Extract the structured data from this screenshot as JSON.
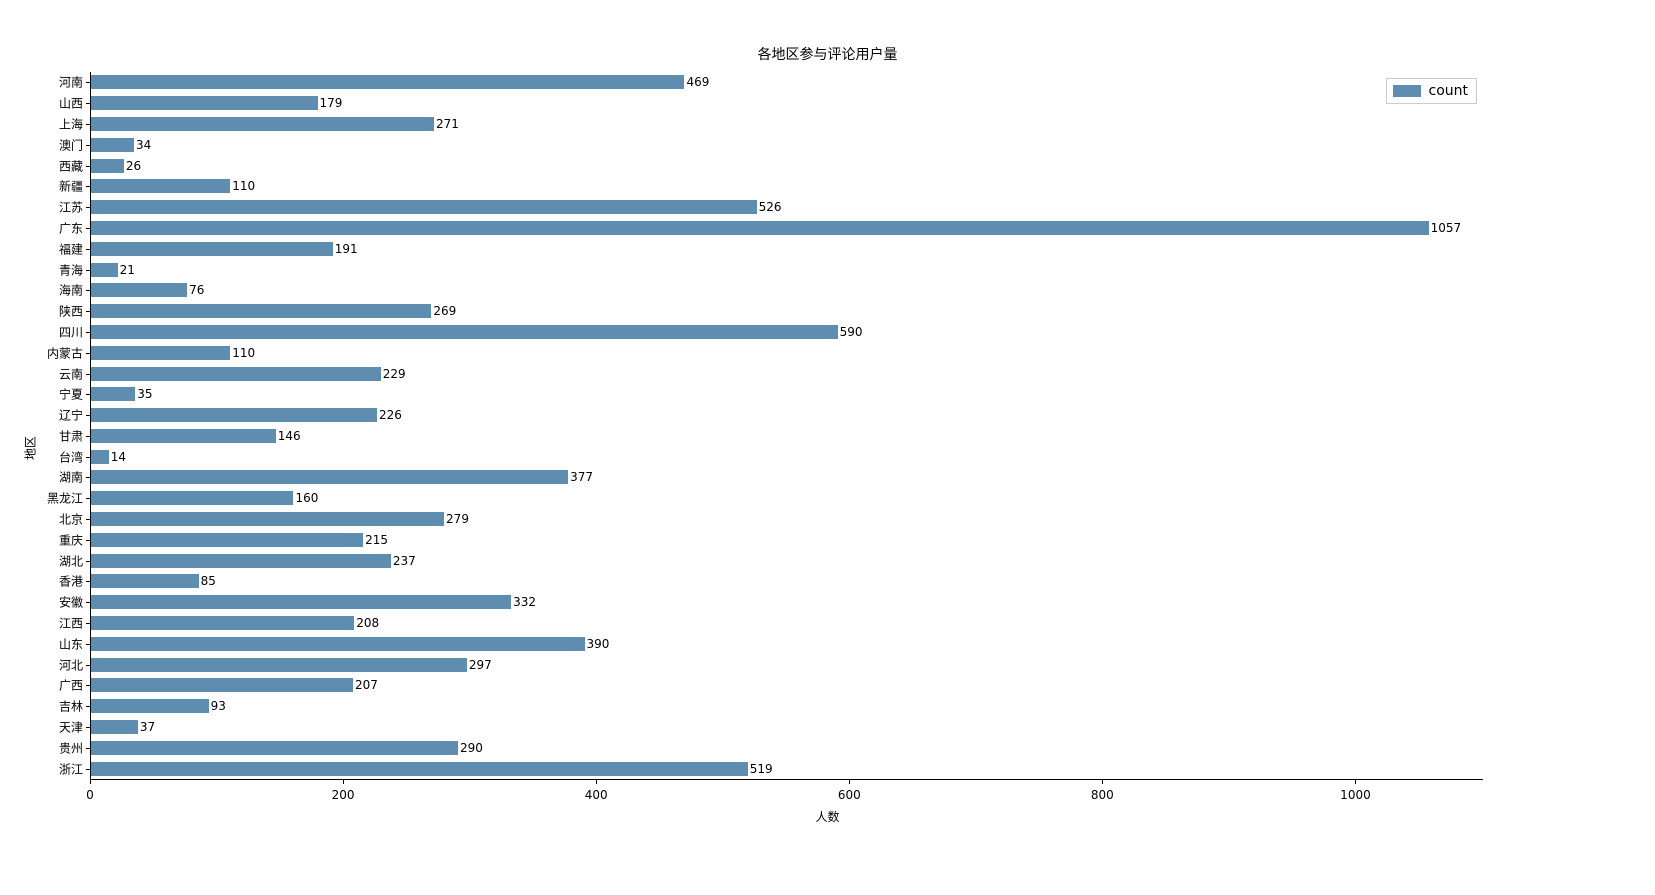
{
  "chart_data": {
    "type": "bar",
    "orientation": "horizontal",
    "title": "各地区参与评论用户量",
    "xlabel": "人数",
    "ylabel": "地区",
    "xlim": [
      0,
      1100
    ],
    "xticks": [
      0,
      200,
      400,
      600,
      800,
      1000
    ],
    "legend_label": "count",
    "bar_color": "#5f8db0",
    "categories": [
      "河南",
      "山西",
      "上海",
      "澳门",
      "西藏",
      "新疆",
      "江苏",
      "广东",
      "福建",
      "青海",
      "海南",
      "陕西",
      "四川",
      "内蒙古",
      "云南",
      "宁夏",
      "辽宁",
      "甘肃",
      "台湾",
      "湖南",
      "黑龙江",
      "北京",
      "重庆",
      "湖北",
      "香港",
      "安徽",
      "江西",
      "山东",
      "河北",
      "广西",
      "吉林",
      "天津",
      "贵州",
      "浙江"
    ],
    "values": [
      469,
      179,
      271,
      34,
      26,
      110,
      526,
      1057,
      191,
      21,
      76,
      269,
      590,
      110,
      229,
      35,
      226,
      146,
      14,
      377,
      160,
      279,
      215,
      237,
      85,
      332,
      208,
      390,
      297,
      207,
      93,
      37,
      290,
      519
    ]
  }
}
